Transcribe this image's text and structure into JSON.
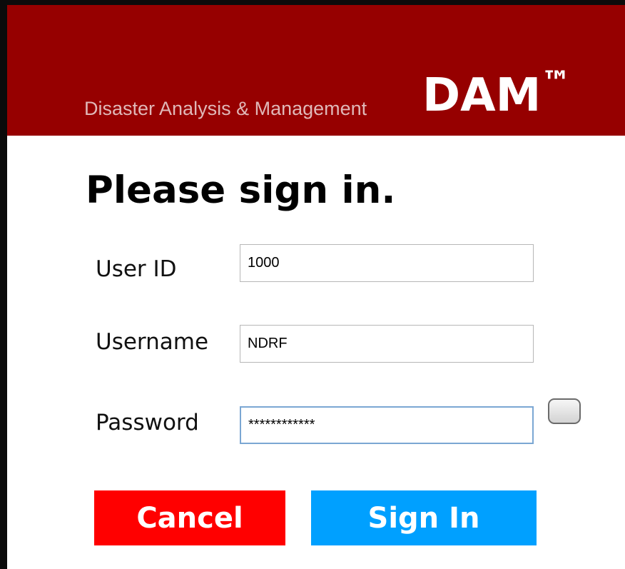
{
  "header": {
    "tagline": "Disaster Analysis & Management",
    "brand": "DAM",
    "trademark": "™",
    "background_color": "#960000"
  },
  "form": {
    "title": "Please sign in.",
    "user_id": {
      "label": "User ID",
      "value": "1000"
    },
    "username": {
      "label": "Username",
      "value": "NDRF"
    },
    "password": {
      "label": "Password",
      "value": "************"
    },
    "show_password_checked": false
  },
  "buttons": {
    "cancel": {
      "label": "Cancel",
      "color": "#ff0000"
    },
    "sign_in": {
      "label": "Sign In",
      "color": "#00a0ff"
    }
  }
}
